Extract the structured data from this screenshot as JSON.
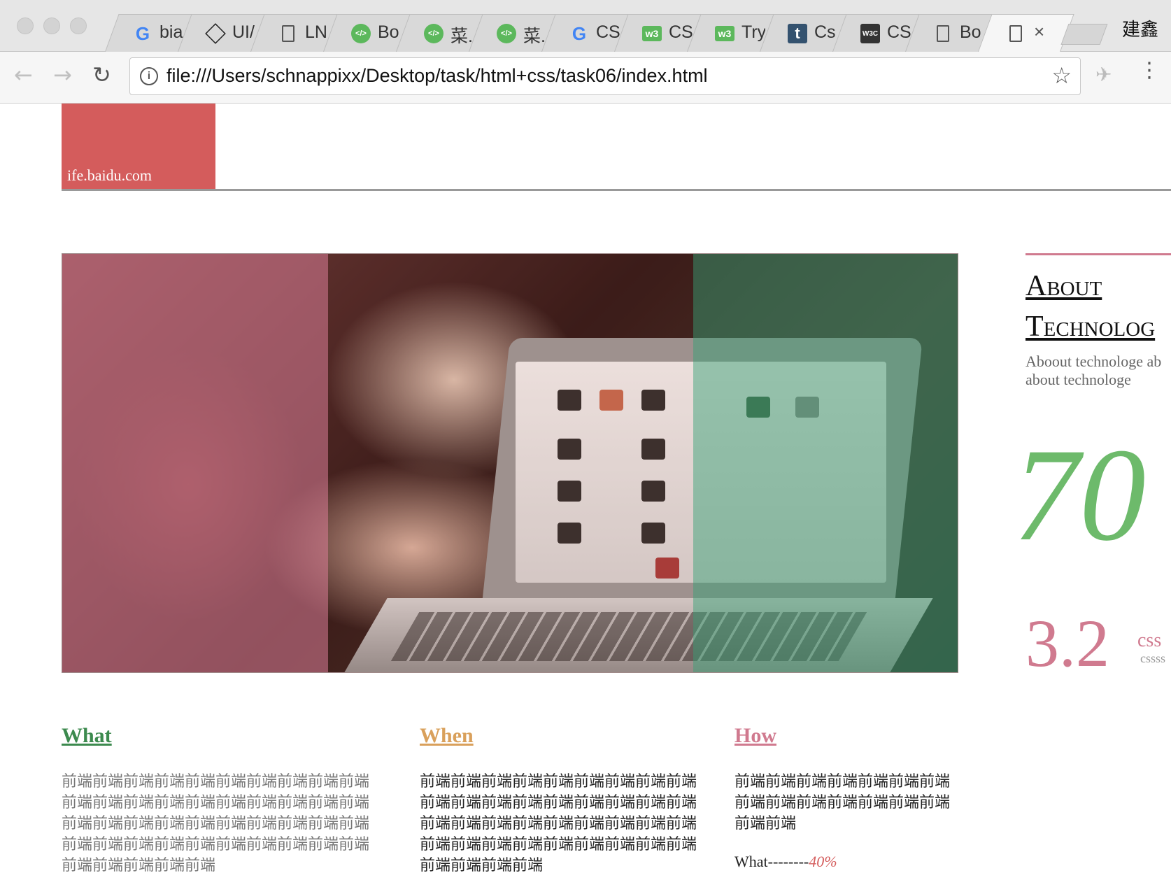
{
  "browser": {
    "tabs": [
      {
        "icon": "google-icon",
        "title": "bia",
        "active": false
      },
      {
        "icon": "codepen-icon",
        "title": "UI/",
        "active": false
      },
      {
        "icon": "document-icon",
        "title": "LN",
        "active": false
      },
      {
        "icon": "runoob-icon",
        "title": "Bo",
        "active": false
      },
      {
        "icon": "runoob-icon",
        "title": "菜.",
        "active": false
      },
      {
        "icon": "runoob-icon",
        "title": "菜.",
        "active": false
      },
      {
        "icon": "google-icon",
        "title": "CS",
        "active": false
      },
      {
        "icon": "w3schools-icon",
        "title": "CS",
        "active": false
      },
      {
        "icon": "w3schools-icon",
        "title": "Try",
        "active": false
      },
      {
        "icon": "tumblr-icon",
        "title": "Cs",
        "active": false
      },
      {
        "icon": "w3c-icon",
        "title": "CS",
        "active": false
      },
      {
        "icon": "document-icon",
        "title": "Bo",
        "active": false
      },
      {
        "icon": "document-icon",
        "title": "",
        "active": true
      }
    ],
    "profile_name": "建鑫",
    "address": "file:///Users/schnappixx/Desktop/task/html+css/task06/index.html"
  },
  "header": {
    "logo_text": "ife.baidu.com"
  },
  "about": {
    "title_line1": "About",
    "title_line2": "Technolog",
    "desc_line1": "Aboout technologe ab",
    "desc_line2": "about technologe",
    "big_number": "70",
    "version_number": "3.2",
    "version_label": "css",
    "version_sub": "cssss"
  },
  "columns": [
    {
      "heading": "What",
      "color": "#3c8a4e",
      "text_color": "#777",
      "text": "前端前端前端前端前端前端前端前端前端前端前端前端前端前端前端前端前端前端前端前端前端前端前端前端前端前端前端前端前端前端前端前端前端前端前端前端前端前端前端前端前端前端前端前端前端"
    },
    {
      "heading": "When",
      "color": "#d9a05b",
      "text_color": "#222",
      "text": "前端前端前端前端前端前端前端前端前端前端前端前端前端前端前端前端前端前端前端前端前端前端前端前端前端前端前端前端前端前端前端前端前端前端前端前端前端前端前端前端"
    },
    {
      "heading": "How",
      "color": "#d07a8f",
      "text_color": "#222",
      "text": "前端前端前端前端前端前端前端前端前端前端前端前端前端前端前端前端"
    }
  ],
  "stat": {
    "label": "What--------",
    "value": "40%"
  }
}
